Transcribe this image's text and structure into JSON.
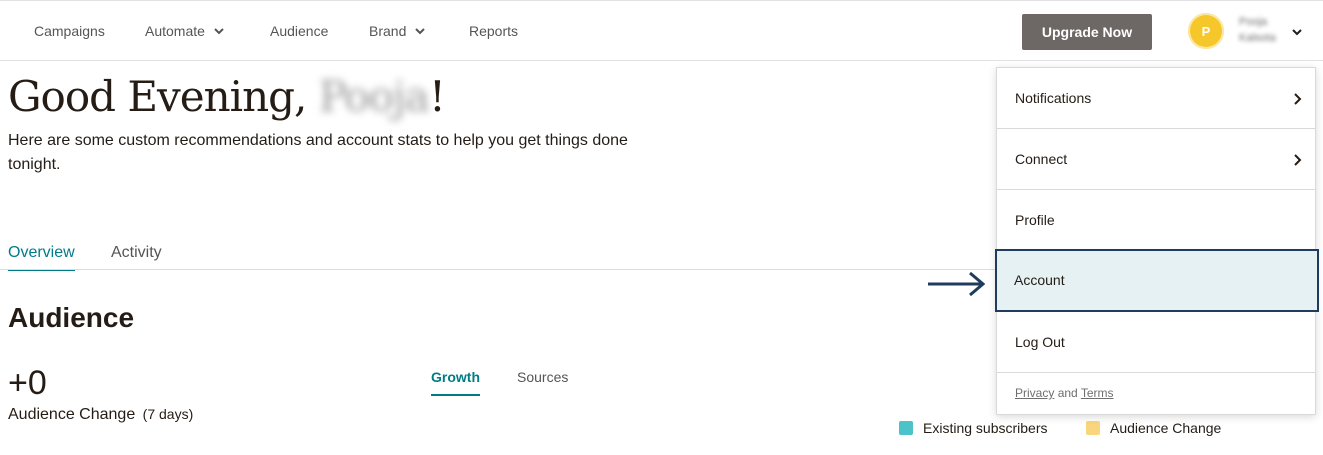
{
  "nav": {
    "items": [
      {
        "label": "Campaigns",
        "has_dropdown": false
      },
      {
        "label": "Automate",
        "has_dropdown": true
      },
      {
        "label": "Audience",
        "has_dropdown": false
      },
      {
        "label": "Brand",
        "has_dropdown": true
      },
      {
        "label": "Reports",
        "has_dropdown": false
      }
    ],
    "upgrade_label": "Upgrade Now",
    "avatar_initial": "P",
    "user_name_line1": "Pooja",
    "user_name_line2": "Kalsota"
  },
  "greeting": {
    "prefix": "Good Evening, ",
    "name": "Pooja",
    "suffix": "!",
    "subtitle": "Here are some custom recommendations and account stats to help you get things done tonight."
  },
  "tabs": [
    {
      "label": "Overview",
      "active": true
    },
    {
      "label": "Activity",
      "active": false
    }
  ],
  "audience": {
    "title": "Audience",
    "change_value": "+0",
    "change_label": "Audience Change",
    "change_period": "(7 days)",
    "subtabs": [
      {
        "label": "Growth",
        "active": true
      },
      {
        "label": "Sources",
        "active": false
      }
    ],
    "legend": [
      {
        "label": "Existing subscribers",
        "color": "#4cc3c9"
      },
      {
        "label": "Audience Change",
        "color": "#f9d57d"
      }
    ]
  },
  "dropdown": {
    "items": [
      {
        "label": "Notifications",
        "has_submenu": true
      },
      {
        "label": "Connect",
        "has_submenu": true
      },
      {
        "label": "Profile",
        "has_submenu": false
      },
      {
        "label": "Account",
        "has_submenu": false,
        "highlighted": true
      },
      {
        "label": "Log Out",
        "has_submenu": false
      }
    ],
    "footer_privacy": "Privacy",
    "footer_and": "and",
    "footer_terms": "Terms"
  },
  "colors": {
    "accent": "#007c89",
    "upgrade_button": "#6d6865",
    "highlight_border": "#1f3b5e",
    "highlight_bg": "#e6f1f3"
  }
}
